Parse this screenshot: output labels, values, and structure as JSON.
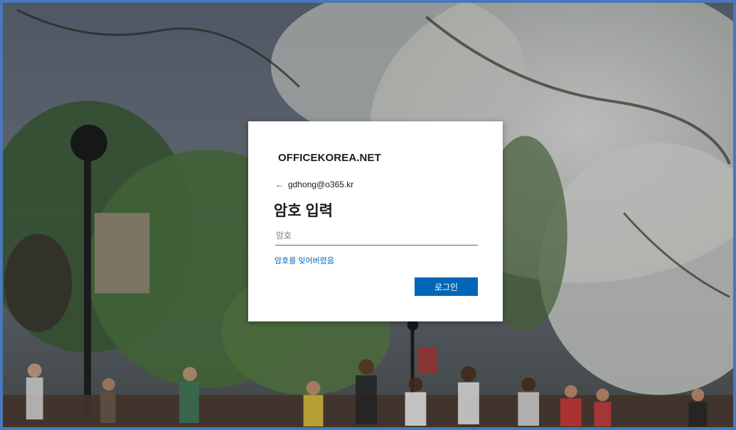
{
  "dialog": {
    "brand": "OFFICEKOREA.NET",
    "identity": "gdhong@o365.kr",
    "heading": "암호 입력",
    "password_placeholder": "암호",
    "password_value": "",
    "forgot_link": "암호를 잊어버렸음",
    "signin_button": "로그인"
  },
  "colors": {
    "accent": "#0067b8",
    "frame_border": "#4a78b8"
  },
  "icons": {
    "back": "left-arrow-icon"
  }
}
